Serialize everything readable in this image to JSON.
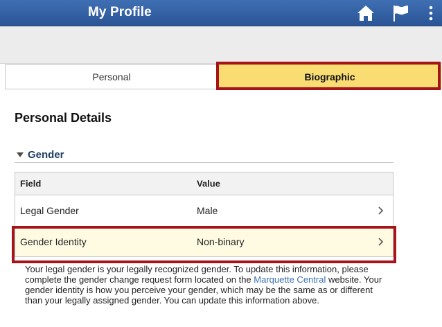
{
  "header": {
    "title": "My Profile",
    "icons": [
      "home-icon",
      "flag-icon",
      "more-vertical-icon"
    ]
  },
  "tabs": [
    {
      "label": "Personal",
      "selected": false
    },
    {
      "label": "Biographic",
      "selected": true
    }
  ],
  "section": {
    "title": "Personal Details"
  },
  "group": {
    "label": "Gender",
    "expanded": true
  },
  "table": {
    "columns": [
      "Field",
      "Value"
    ],
    "rows": [
      {
        "field": "Legal Gender",
        "value": "Male"
      },
      {
        "field": "Gender Identity",
        "value": "Non-binary"
      }
    ]
  },
  "note": {
    "text_before_link": "Your legal gender is your legally recognized gender. To update this information, please complete the gender change request form located on the ",
    "link_text": "Marquette Central",
    "text_after_link": " website. Your gender identity is how you perceive your gender, which may be the same as or different than your legally assigned gender. You can update this information above."
  },
  "colors": {
    "header_bar": "#2f5d9e",
    "selected_tab": "#f9dc72",
    "highlight_outline": "#a61419",
    "link": "#3a6fb0"
  }
}
